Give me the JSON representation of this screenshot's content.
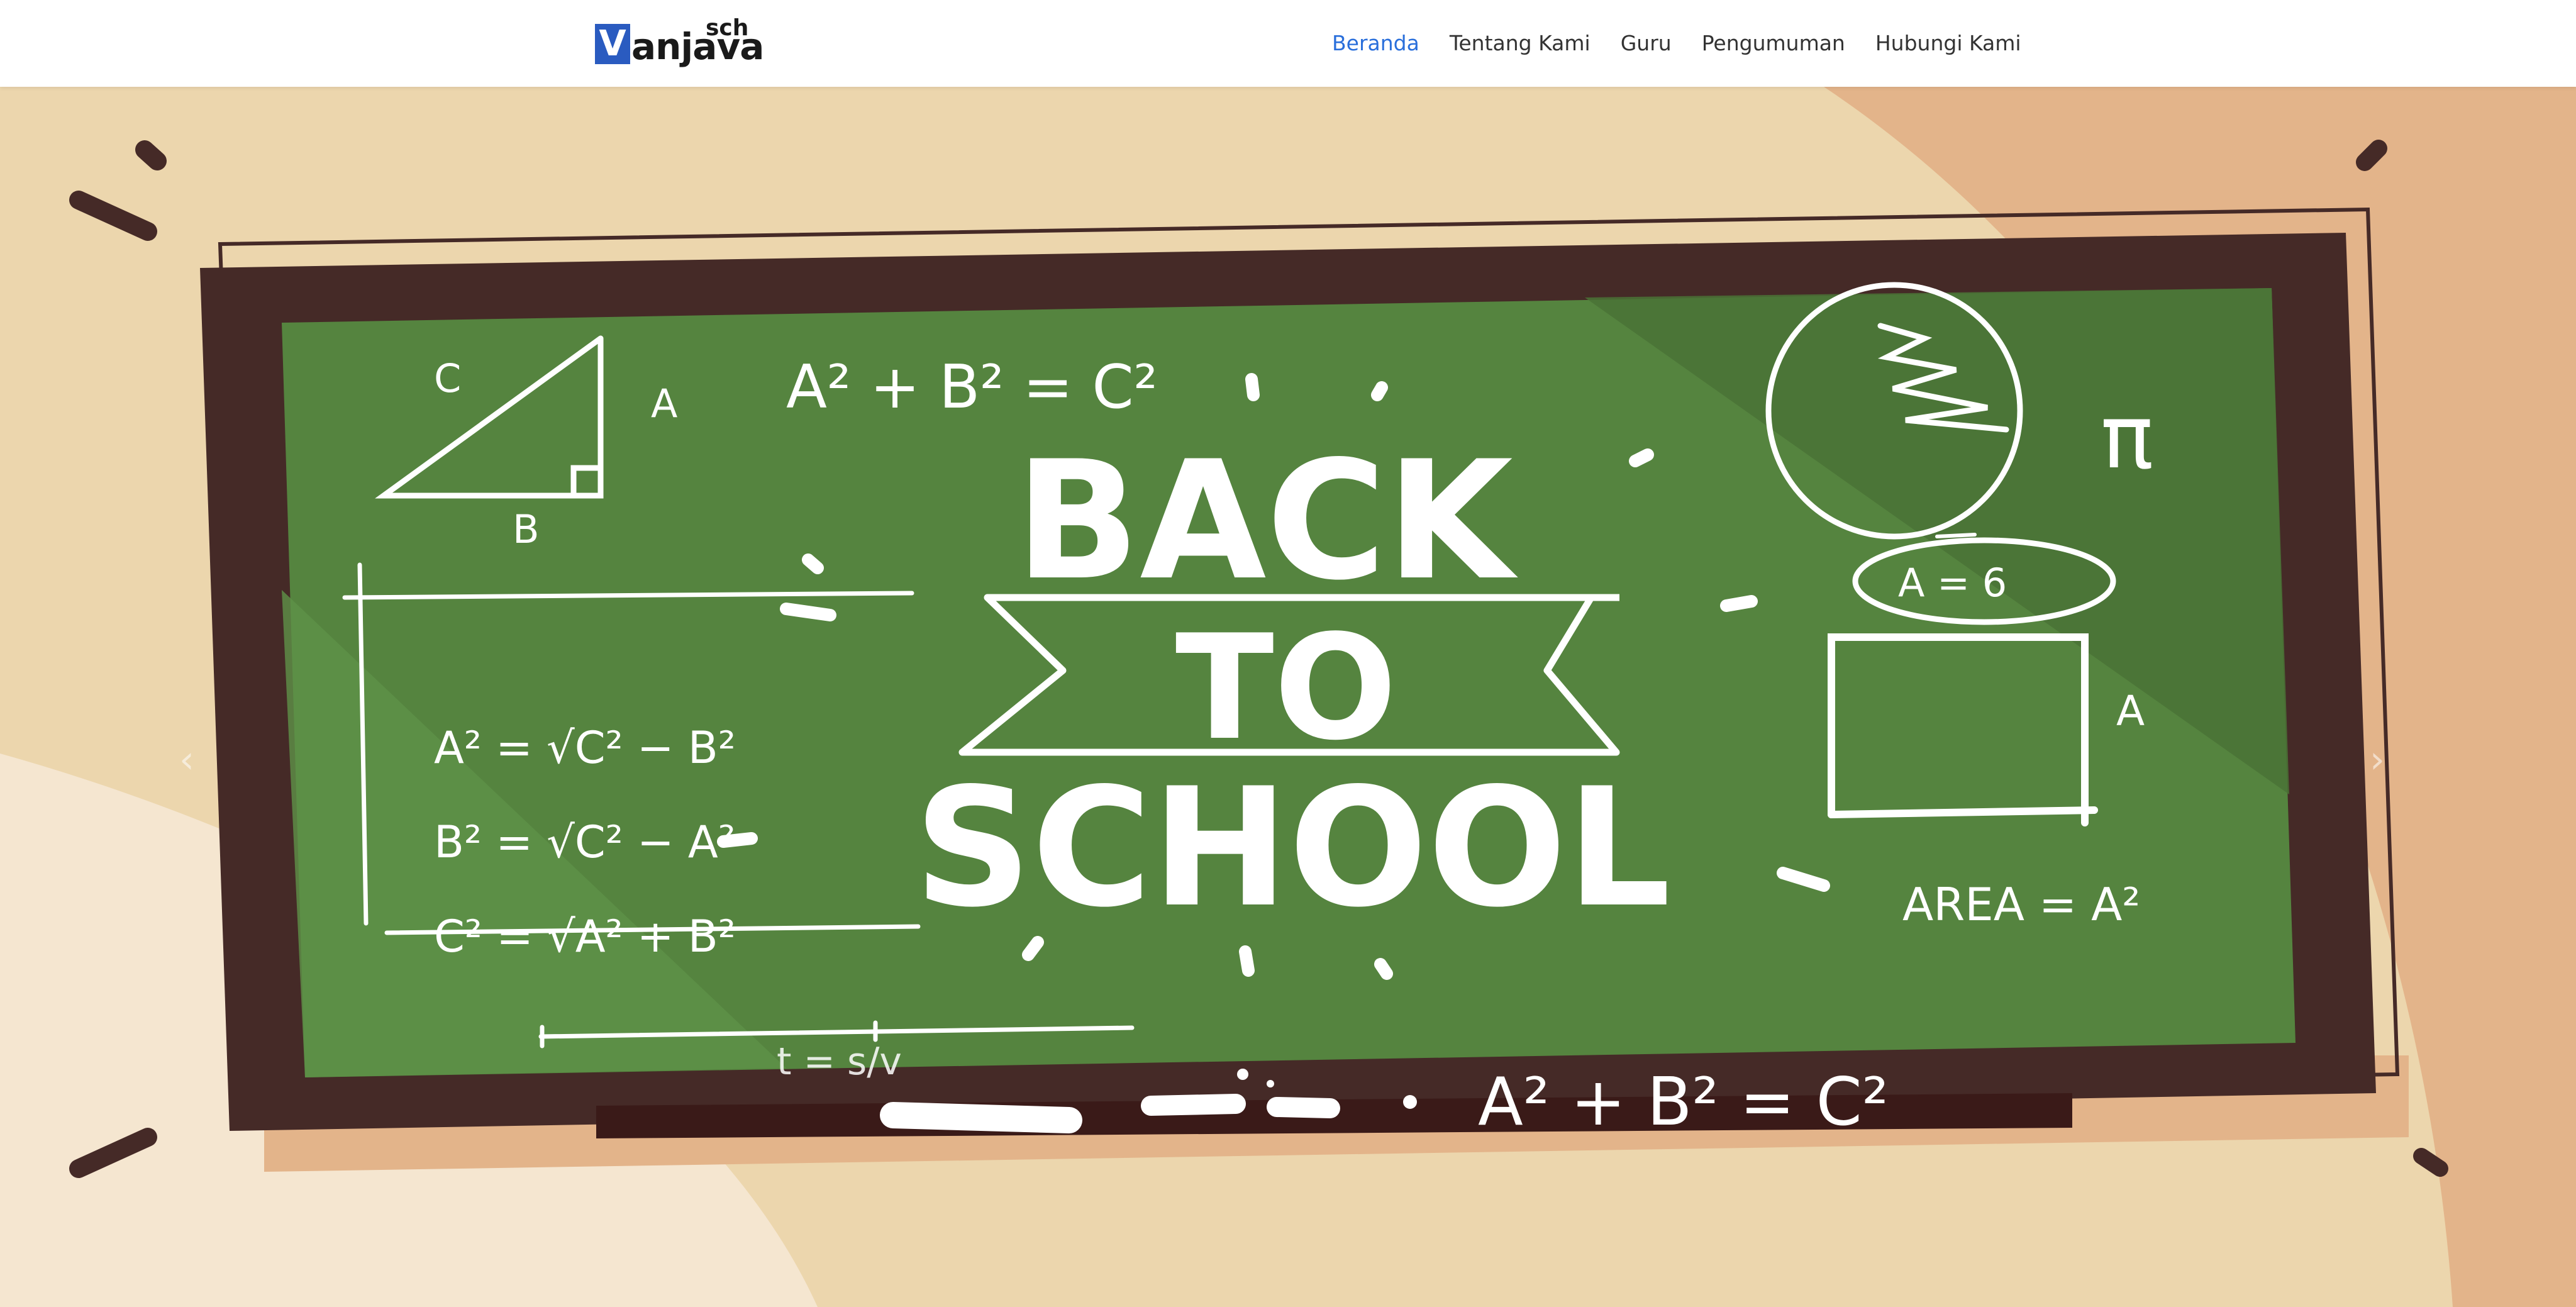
{
  "logo": {
    "letter": "V",
    "word": "anjava",
    "sup": "sch"
  },
  "nav": {
    "items": [
      {
        "label": "Beranda",
        "active": true
      },
      {
        "label": "Tentang Kami",
        "active": false
      },
      {
        "label": "Guru",
        "active": false
      },
      {
        "label": "Pengumuman",
        "active": false
      },
      {
        "label": "Hubungi Kami",
        "active": false
      }
    ]
  },
  "hero": {
    "headline": {
      "line1": "BACK",
      "line2": "TO",
      "line3": "SCHOOL"
    },
    "formulas": {
      "top": "A² + B² = C²",
      "bottom": "A² + B² = C²",
      "a_sq": "A² = √C² − B²",
      "b_sq": "B² = √C² − A²",
      "c_sq": "C² = √A² + B²",
      "time": "t = s/v",
      "area_label": "A = 6",
      "area": "AREA = A²",
      "pi": "π",
      "tri_a": "A",
      "tri_b": "B",
      "tri_c": "C",
      "square_a": "A"
    },
    "prev_icon": "chevron-left-icon",
    "next_icon": "chevron-right-icon"
  },
  "colors": {
    "nav_active": "#2a6fdb",
    "board_green": "#55843f",
    "board_frame": "#452a27",
    "bg_cream": "#ecd6ad",
    "bg_tan": "#e3b48a"
  }
}
